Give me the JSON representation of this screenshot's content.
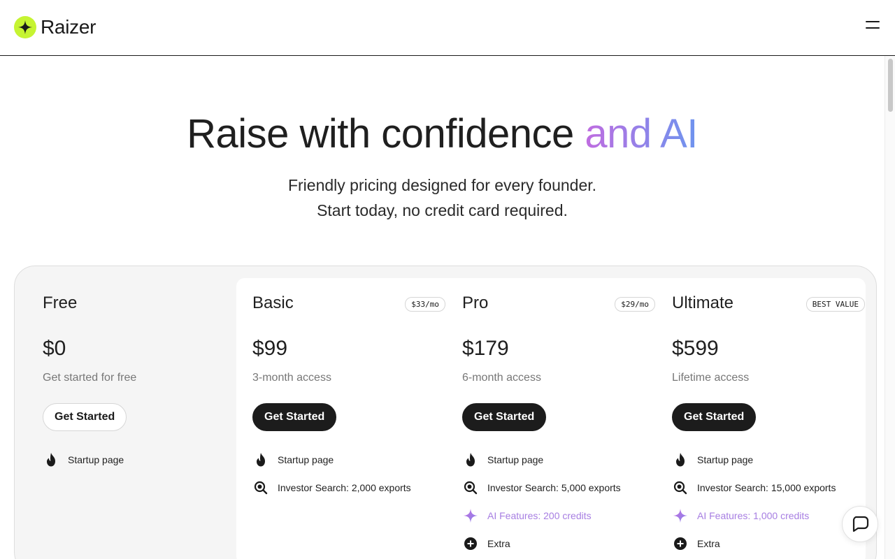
{
  "header": {
    "brand": "Raizer",
    "logo_icon": "sparkle-icon",
    "menu_icon": "hamburger-menu-icon"
  },
  "hero": {
    "title_main": "Raise with confidence ",
    "title_accent": "and AI",
    "subtitle_line1": "Friendly pricing designed for every founder.",
    "subtitle_line2": "Start today, no credit card required."
  },
  "colors": {
    "brand_lime": "#c6f432",
    "dark_button": "#1c1c1c",
    "ai_accent": "#a77ee2",
    "gradient_start": "#c06ce0",
    "gradient_end": "#6e94ee"
  },
  "plans": [
    {
      "name": "Free",
      "badge": "",
      "price": "$0",
      "desc": "Get started for free",
      "cta": "Get Started",
      "features": [
        {
          "icon": "flame-icon",
          "label": "Startup page"
        }
      ]
    },
    {
      "name": "Basic",
      "badge": "$33/mo",
      "price": "$99",
      "desc": "3-month access",
      "cta": "Get Started",
      "features": [
        {
          "icon": "flame-icon",
          "label": "Startup page"
        },
        {
          "icon": "search-icon",
          "label": "Investor Search: 2,000 exports"
        }
      ]
    },
    {
      "name": "Pro",
      "badge": "$29/mo",
      "price": "$179",
      "desc": "6-month access",
      "cta": "Get Started",
      "features": [
        {
          "icon": "flame-icon",
          "label": "Startup page"
        },
        {
          "icon": "search-icon",
          "label": "Investor Search: 5,000 exports"
        },
        {
          "icon": "sparkle-icon",
          "label": "AI Features: 200 credits"
        },
        {
          "icon": "plus-circle-icon",
          "label": "Extra"
        }
      ]
    },
    {
      "name": "Ultimate",
      "badge": "BEST VALUE",
      "price": "$599",
      "desc": "Lifetime access",
      "cta": "Get Started",
      "features": [
        {
          "icon": "flame-icon",
          "label": "Startup page"
        },
        {
          "icon": "search-icon",
          "label": "Investor Search: 15,000 exports"
        },
        {
          "icon": "sparkle-icon",
          "label": "AI Features: 1,000 credits"
        },
        {
          "icon": "plus-circle-icon",
          "label": "Extra"
        }
      ]
    }
  ],
  "chat": {
    "icon": "chat-bubble-icon"
  }
}
